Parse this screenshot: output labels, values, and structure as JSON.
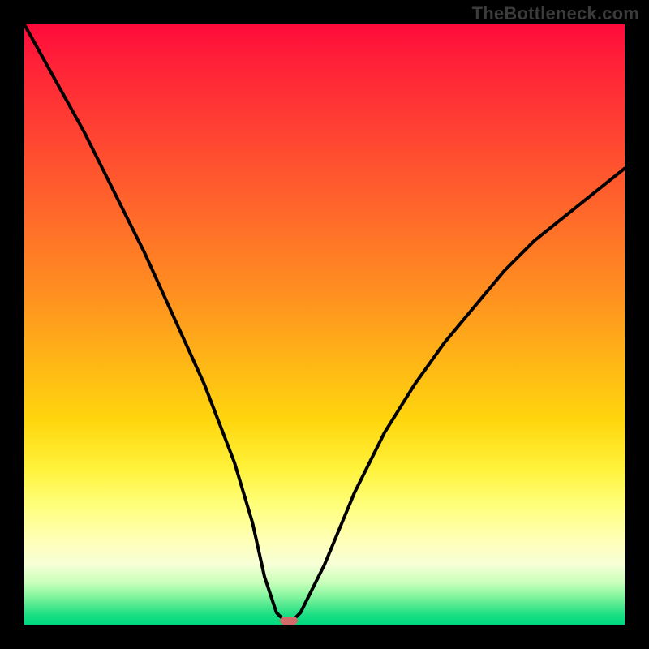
{
  "watermark": "TheBottleneck.com",
  "colors": {
    "frame_bg": "#000000",
    "curve_stroke": "#000000",
    "marker_fill": "#d46a6a",
    "watermark_color": "#3b3b3b"
  },
  "chart_data": {
    "type": "line",
    "title": "",
    "xlabel": "",
    "ylabel": "",
    "xlim": [
      0,
      100
    ],
    "ylim": [
      0,
      100
    ],
    "grid": false,
    "legend": false,
    "gradient_stops": [
      {
        "pos": 0,
        "color": "#ff0a3a"
      },
      {
        "pos": 0.18,
        "color": "#ff4232"
      },
      {
        "pos": 0.45,
        "color": "#ff9020"
      },
      {
        "pos": 0.66,
        "color": "#ffd60e"
      },
      {
        "pos": 0.8,
        "color": "#ffff7a"
      },
      {
        "pos": 0.93,
        "color": "#c8ffba"
      },
      {
        "pos": 1.0,
        "color": "#00d97e"
      }
    ],
    "series": [
      {
        "name": "bottleneck-curve",
        "x": [
          0,
          5,
          10,
          15,
          20,
          25,
          30,
          35,
          38,
          40,
          42,
          44,
          46,
          50,
          55,
          60,
          65,
          70,
          75,
          80,
          85,
          90,
          95,
          100
        ],
        "y": [
          100,
          91,
          82,
          72,
          62,
          51,
          40,
          27,
          17,
          8,
          2,
          0,
          2,
          10,
          22,
          32,
          40,
          47,
          53,
          59,
          64,
          68,
          72,
          76
        ]
      }
    ],
    "marker": {
      "x": 44,
      "y": 0,
      "width": 3,
      "height": 1.4
    },
    "notes": "Values are approximate, read from pixel positions; axes are unlabeled in source image."
  }
}
